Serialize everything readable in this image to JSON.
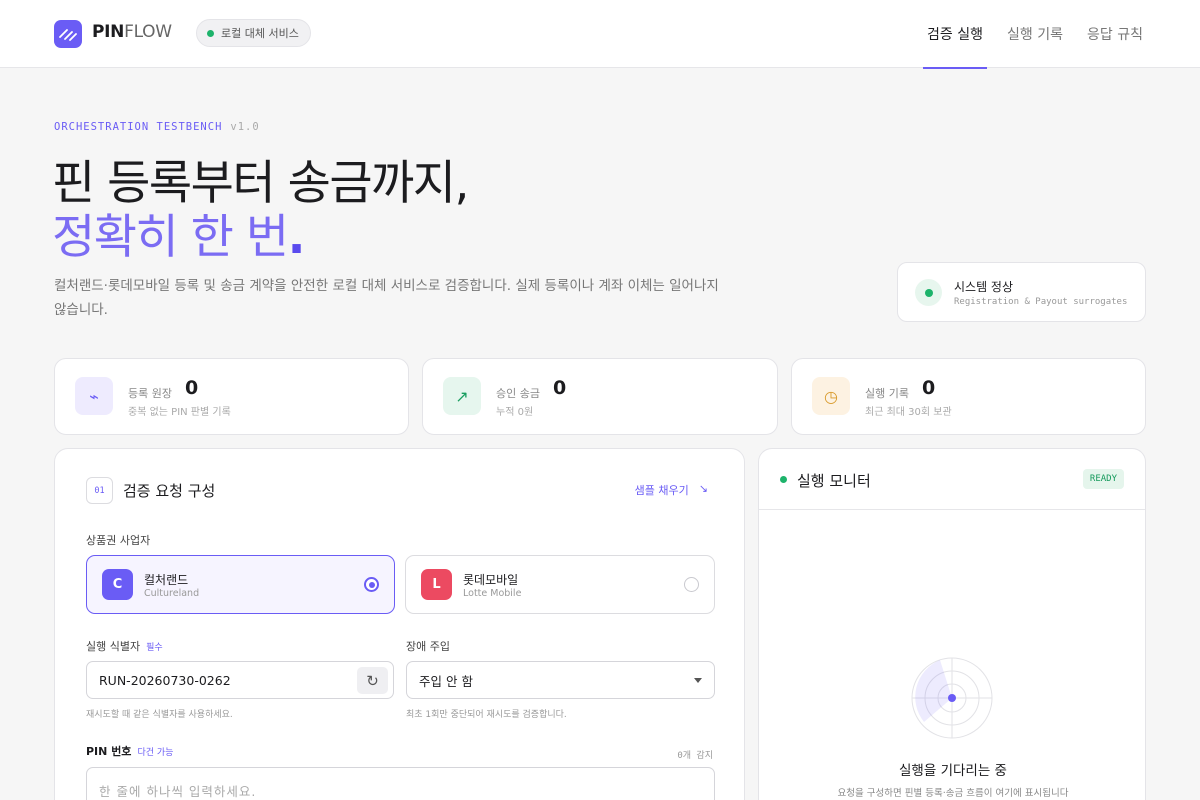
{
  "header": {
    "logo_bold": "PIN",
    "logo_light": "FLOW",
    "service_pill": "로컬 대체 서비스",
    "tabs": [
      {
        "label": "검증 실행",
        "active": true
      },
      {
        "label": "실행 기록",
        "active": false
      },
      {
        "label": "응답 규칙",
        "active": false
      }
    ]
  },
  "hero": {
    "eyebrow": "ORCHESTRATION TESTBENCH",
    "version": "v1.0",
    "title_line1": "핀 등록부터 송금까지,",
    "title_line2": "정확히 한 번",
    "title_dot": ".",
    "description": "컬처랜드·롯데모바일 등록 및 송금 계약을 안전한 로컬 대체 서비스로 검증합니다. 실제 등록이나 계좌 이체는 일어나지 않습니다."
  },
  "system_status": {
    "title": "시스템 정상",
    "subtitle": "Registration & Payout surrogates"
  },
  "stats": [
    {
      "label": "등록 원장",
      "value": "0",
      "sub": "중복 없는 PIN 판별 기록",
      "icon": "pulse-icon",
      "glyph": "⌁"
    },
    {
      "label": "승인 송금",
      "value": "0",
      "sub": "누적 0원",
      "icon": "trend-up-icon",
      "glyph": "↗"
    },
    {
      "label": "실행 기록",
      "value": "0",
      "sub": "최근 최대 30회 보관",
      "icon": "clock-icon",
      "glyph": "◷"
    }
  ],
  "request_panel": {
    "step": "01",
    "title": "검증 요청 구성",
    "sample_link": "샘플 채우기",
    "sample_arrow": "↘",
    "vendor_label": "상품권 사업자",
    "vendors": [
      {
        "initial": "C",
        "name": "컬처랜드",
        "sub": "Cultureland",
        "selected": true,
        "color": "#6a5cf5"
      },
      {
        "initial": "L",
        "name": "롯데모바일",
        "sub": "Lotte Mobile",
        "selected": false,
        "color": "#ec4a61"
      }
    ],
    "run_id_label": "실행 식별자",
    "run_id_required": "필수",
    "run_id_value": "RUN-20260730-0262",
    "run_id_hint": "재시도할 때 같은 식별자를 사용하세요.",
    "fault_label": "장애 주입",
    "fault_value": "주입 안 함",
    "fault_hint": "최초 1회만 중단되어 재시도를 검증합니다.",
    "pin_label": "PIN 번호",
    "pin_multi": "다건 가능",
    "pin_count": "0개 감지",
    "pin_placeholder": "한 줄에 하나씩 입력하세요."
  },
  "monitor": {
    "title": "실행 모니터",
    "badge": "READY",
    "waiting_title": "실행을 기다리는 중",
    "waiting_sub": "요청을 구성하면 핀별 등록·송금 흐름이 여기에 표시됩니다"
  }
}
